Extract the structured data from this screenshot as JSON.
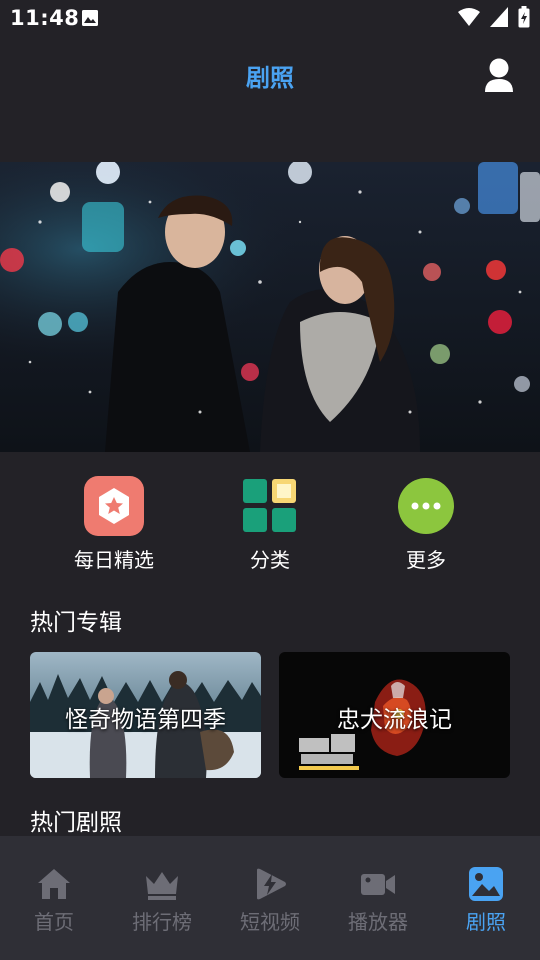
{
  "status": {
    "time": "11:48"
  },
  "header": {
    "title": "剧照"
  },
  "quick_links": [
    {
      "label": "每日精选",
      "icon": "star-badge-icon",
      "color": "#ef7b70"
    },
    {
      "label": "分类",
      "icon": "grid-icon",
      "color": "#1aa07a"
    },
    {
      "label": "更多",
      "icon": "more-dots-icon",
      "color": "#8cc63e"
    }
  ],
  "sections": {
    "hot_albums": "热门专辑",
    "hot_stills": "热门剧照"
  },
  "albums": [
    {
      "title": "怪奇物语第四季"
    },
    {
      "title": "忠犬流浪记"
    }
  ],
  "tabs": [
    {
      "label": "首页",
      "icon": "home-icon"
    },
    {
      "label": "排行榜",
      "icon": "crown-icon"
    },
    {
      "label": "短视频",
      "icon": "lightning-play-icon"
    },
    {
      "label": "播放器",
      "icon": "video-camera-icon"
    },
    {
      "label": "剧照",
      "icon": "photo-icon",
      "active": true
    }
  ],
  "colors": {
    "accent": "#4aa3f2",
    "background": "#232227",
    "tabbar": "#2f2f36",
    "inactive": "#6d6d76"
  }
}
